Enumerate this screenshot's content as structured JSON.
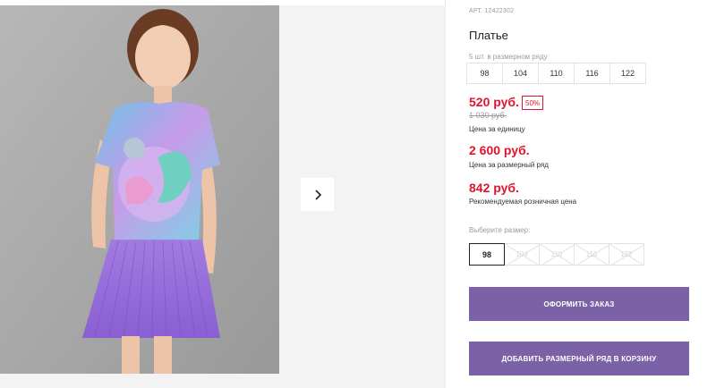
{
  "product": {
    "article": "АРТ. 12422302",
    "title": "Платье",
    "sizes_label": "5 шт. в размерном ряду",
    "sizes": [
      "98",
      "104",
      "110",
      "116",
      "122"
    ]
  },
  "pricing": {
    "price": "520 руб.",
    "discount": "50%",
    "old_price": "1 030 руб.",
    "unit_caption": "Цена за единицу",
    "row_price": "2 600 руб.",
    "row_caption": "Цена за размерный ряд",
    "rrp_price": "842 руб.",
    "rrp_caption": "Рекомендуемая розничная цена"
  },
  "size_picker": {
    "label": "Выберите размер:",
    "options": [
      "98",
      "104",
      "110",
      "116",
      "122"
    ],
    "selected": "98"
  },
  "actions": {
    "order_label": "ОФОРМИТЬ ЗАКАЗ",
    "cart_label": "ДОБАВИТЬ РАЗМЕРНЫЙ РЯД В КОРЗИНУ"
  },
  "colors": {
    "accent": "#7b62a6",
    "price": "#e2142d"
  },
  "icons": {
    "next": "chevron-right-icon"
  }
}
